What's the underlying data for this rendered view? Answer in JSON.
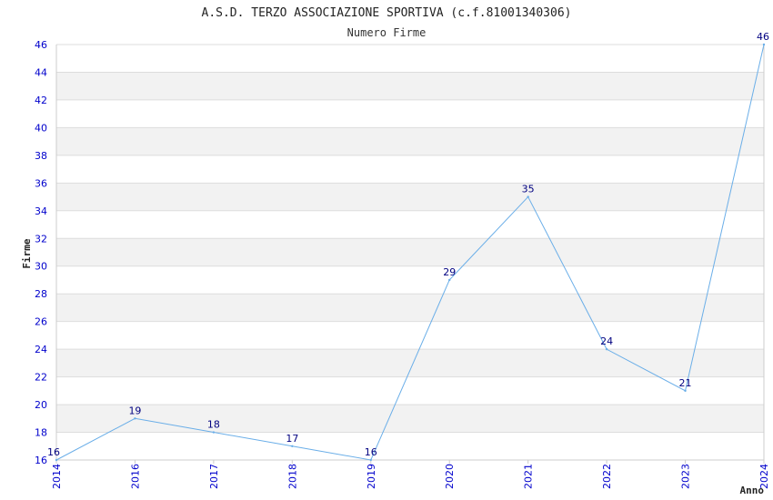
{
  "chart_data": {
    "type": "line",
    "title": "A.S.D. TERZO ASSOCIAZIONE SPORTIVA (c.f.81001340306)",
    "subtitle": "Numero Firme",
    "xlabel": "Anno",
    "ylabel": "Firme",
    "x": [
      "2014",
      "2016",
      "2017",
      "2018",
      "2019",
      "2020",
      "2021",
      "2022",
      "2023",
      "2024"
    ],
    "values": [
      16,
      19,
      18,
      17,
      16,
      29,
      35,
      24,
      21,
      46
    ],
    "ylim": [
      16,
      46
    ],
    "yticks": [
      16,
      18,
      20,
      22,
      24,
      26,
      28,
      30,
      32,
      34,
      36,
      38,
      40,
      42,
      44,
      46
    ],
    "grid": true,
    "colors": {
      "line": "#6aaee8",
      "tick_text": "#0000cc",
      "data_label": "#000080",
      "band_alt": "#f2f2f2",
      "grid": "#dddddd",
      "axis": "#cccccc"
    }
  }
}
